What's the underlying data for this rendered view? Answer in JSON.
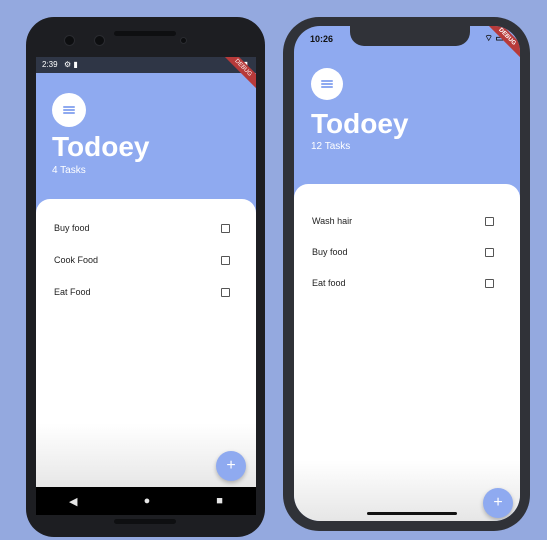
{
  "android": {
    "status_time": "2:39",
    "status_icons_right": "▾ ▮",
    "status_icons_left": "⚙ ▮",
    "debug_banner": "DEBUG",
    "title": "Todoey",
    "subtitle": "4 Tasks",
    "tasks": [
      {
        "label": "Buy food"
      },
      {
        "label": "Cook Food"
      },
      {
        "label": "Eat Food"
      }
    ],
    "fab_label": "+",
    "nav": {
      "back": "◀",
      "home": "●",
      "recent": "■"
    }
  },
  "iphone": {
    "status_time": "10:26",
    "status_icons_right": "⌔ ▭",
    "debug_banner": "DEBUG",
    "title": "Todoey",
    "subtitle": "12 Tasks",
    "tasks": [
      {
        "label": "Wash hair"
      },
      {
        "label": "Buy food"
      },
      {
        "label": "Eat food"
      }
    ],
    "fab_label": "+"
  },
  "colors": {
    "background": "#94a9df",
    "accent": "#8faaf0",
    "card": "#ffffff"
  },
  "icons": {
    "avatar": "list-icon",
    "fab": "add-icon",
    "checkbox": "checkbox-empty-icon"
  }
}
